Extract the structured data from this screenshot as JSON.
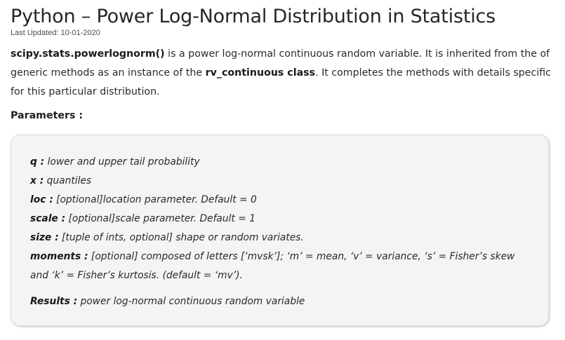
{
  "article": {
    "title": "Python – Power Log-Normal Distribution in Statistics",
    "last_updated": "Last Updated: 10-01-2020",
    "intro": {
      "func": "scipy.stats.powerlognorm()",
      "text1": " is a power log-normal continuous random variable. It is inherited from the of generic methods as an instance of the ",
      "class_name": "rv_continuous class",
      "text2": ". It completes the methods with details specific for this particular distribution."
    },
    "params_heading": "Parameters :",
    "params": [
      {
        "name": "q :",
        "desc": " lower and upper tail probability"
      },
      {
        "name": "x :",
        "desc": " quantiles"
      },
      {
        "name": "loc :",
        "desc": " [optional]location parameter. Default = 0"
      },
      {
        "name": "scale :",
        "desc": " [optional]scale parameter. Default = 1"
      },
      {
        "name": "size :",
        "desc": " [tuple of ints, optional] shape or random variates."
      },
      {
        "name": "moments :",
        "desc": " [optional] composed of letters [‘mvsk’]; ‘m’ = mean, ‘v’ = variance, ‘s’ = Fisher’s skew and ‘k’ = Fisher’s kurtosis. (default = ‘mv’)."
      }
    ],
    "results": {
      "name": "Results :",
      "desc": " power log-normal continuous random variable"
    }
  }
}
